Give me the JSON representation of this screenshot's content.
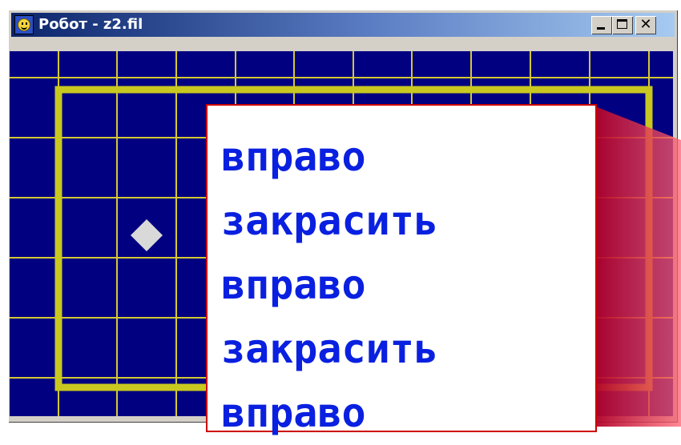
{
  "window": {
    "title": "Робот - z2.fil",
    "icon": "robot-smiley-icon",
    "controls": {
      "minimize": "minimize-icon",
      "maximize": "maximize-icon",
      "close": "close-icon"
    }
  },
  "field": {
    "background_color": "#000080",
    "grid_color": "#d4c832",
    "wall_color": "#c8c820",
    "robot": "robot-diamond-icon",
    "robot_color": "#d9d9d9"
  },
  "commands": [
    "вправо",
    "закрасить",
    "вправо",
    "закрасить",
    "вправо"
  ],
  "colors": {
    "command_text": "#0a20e0",
    "card_border": "#cc0000",
    "shadow": "#cc0020"
  }
}
